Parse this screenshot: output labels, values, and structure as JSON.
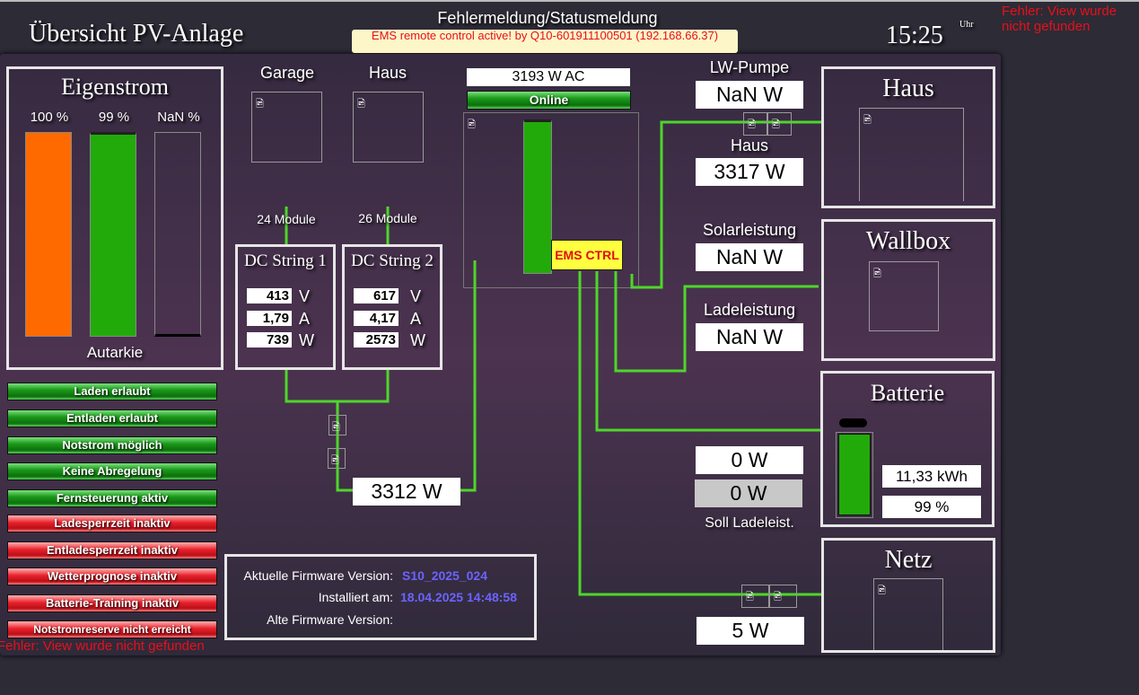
{
  "header": {
    "title": "Übersicht PV-Anlage",
    "status_title": "Fehlermeldung/Statusmeldung",
    "status_message": "EMS remote control active! by Q10-601911100501 (192.168.66.37)",
    "time": "15:25",
    "time_unit": "Uhr",
    "error_top": "Fehler: View wurde nicht gefunden"
  },
  "eigenstrom": {
    "title": "Eigenstrom",
    "bars": [
      {
        "label": "100 %",
        "value": 100,
        "color": "#ff6a00"
      },
      {
        "label": "99 %",
        "value": 99,
        "color": "#22aa0a"
      },
      {
        "label": "NaN %",
        "value": 0,
        "color": "#000000"
      }
    ],
    "footer": "Autarkie"
  },
  "pv": {
    "garage": "Garage",
    "haus": "Haus",
    "modules1": "24 Module",
    "modules2": "26 Module",
    "string1": {
      "title": "DC String 1",
      "v": "413",
      "a": "1,79",
      "w": "739"
    },
    "string2": {
      "title": "DC String 2",
      "v": "617",
      "a": "4,17",
      "w": "2573"
    },
    "units": {
      "v": "V",
      "a": "A",
      "w": "W"
    },
    "total": "3312 W"
  },
  "inverter": {
    "ac": "3193 W AC",
    "status": "Online",
    "ems": "EMS CTRL",
    "fill_percent": 100
  },
  "values": {
    "lw_label": "LW-Pumpe",
    "lw": "NaN W",
    "haus_label": "Haus",
    "haus": "3317 W",
    "solar_label": "Solarleistung",
    "solar": "NaN W",
    "lade_label": "Ladeleistung",
    "lade": "NaN W",
    "w1": "0 W",
    "w2": "0 W",
    "soll_label": "Soll Ladeleist.",
    "netz": "5 W"
  },
  "boxes": {
    "haus": "Haus",
    "wallbox": "Wallbox",
    "batterie": "Batterie",
    "netz": "Netz"
  },
  "battery": {
    "energy": "11,33 kWh",
    "soc": "99 %",
    "soc_value": 99
  },
  "buttons": [
    {
      "label": "Laden erlaubt",
      "state": "green"
    },
    {
      "label": "Entladen erlaubt",
      "state": "green"
    },
    {
      "label": "Notstrom möglich",
      "state": "green"
    },
    {
      "label": "Keine Abregelung",
      "state": "green"
    },
    {
      "label": "Fernsteuerung aktiv",
      "state": "green"
    },
    {
      "label": "Ladesperrzeit inaktiv",
      "state": "red"
    },
    {
      "label": "Entladesperrzeit inaktiv",
      "state": "red"
    },
    {
      "label": "Wetterprognose inaktiv",
      "state": "red"
    },
    {
      "label": "Batterie-Training inaktiv",
      "state": "red"
    },
    {
      "label": "Notstromreserve nicht erreicht",
      "state": "red"
    }
  ],
  "error_bottom": "Fehler: View wurde nicht gefunden",
  "firmware": {
    "current_label": "Aktuelle Firmware Version:",
    "current": "S10_2025_024",
    "installed_label": "Installiert am:",
    "installed": "18.04.2025 14:48:58",
    "old_label": "Alte Firmware Version:",
    "old": ""
  },
  "colors": {
    "line": "#4ed62a",
    "accent_text": "#6b63ff",
    "error": "#e8101a"
  }
}
